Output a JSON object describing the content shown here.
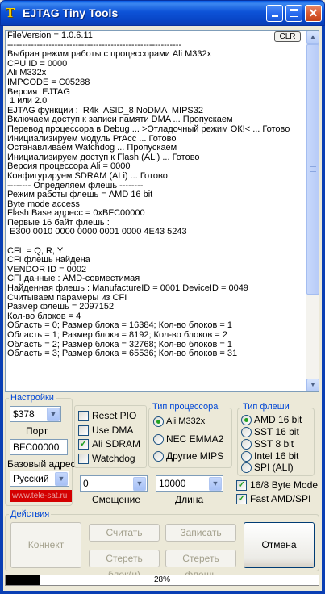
{
  "window": {
    "title": "EJTAG Tiny Tools",
    "icon_glyph": "T"
  },
  "log": {
    "clear_label": "CLR",
    "lines": [
      "FileVersion = 1.0.6.11",
      "-----------------------------------------------------------",
      "Выбран режим работы с процессорами Ali M332x",
      "CPU ID = 0000",
      "Ali M332x",
      "IMPCODE = C05288",
      "Версия  EJTAG",
      " 1 или 2.0",
      "EJTAG функции :  R4k  ASID_8 NoDMA  MIPS32",
      "Включаем доступ к записи памяти DMA ... Пропускаем",
      "Перевод процессора в Debug ... >Отладочный режим ОК!< ... Готово",
      "Инициализируем модуль PrAcc ... Готово",
      "Останавливаем Watchdog ... Пропускаем",
      "Инициализируем доступ к Flash (ALi) ... Готово",
      "Версия процессора Ali = 0000",
      "Конфигурируем SDRAM (ALi) ... Готово",
      "-------- Определяем флешь --------",
      "Режим работы флешь = AMD 16 bit",
      "Byte mode access",
      "Flash Base адресс = 0xBFC00000",
      "Первые 16 байт флешь :",
      " E300 0010 0000 0000 0001 0000 4E43 5243",
      "",
      "CFI  = Q, R, Y",
      "CFI флешь найдена",
      "VENDOR ID = 0002",
      "CFI данные : AMD-совместимая",
      "Найденная флешь : ManufactureID = 0001 DeviceID = 0049",
      "Считываем парамеры из CFI",
      "Размер флешь = 2097152",
      "Кол-во блоков = 4",
      "Область = 0; Размер блока = 16384; Кол-во блоков = 1",
      "Область = 1; Размер блока = 8192; Кол-во блоков = 2",
      "Область = 2; Размер блока = 32768; Кол-во блоков = 1",
      "Область = 3; Размер блока = 65536; Кол-во блоков = 31"
    ]
  },
  "settings": {
    "legend": "Настройки",
    "port_combo_value": "$378",
    "port_label": "Порт",
    "base_value": "BFC00000",
    "base_label": "Базовый адрес",
    "lang_value": "Русский",
    "site_text": "www.tele-sat.ru"
  },
  "options": {
    "reset_pio": "Reset PIO",
    "use_dma": "Use DMA",
    "ali_sdram": "Ali SDRAM",
    "watchdog": "Watchdog"
  },
  "cpu_type": {
    "legend": "Тип процессора",
    "opt1": "Ali M332x",
    "opt2": "NEC EMMA2",
    "opt3": "Другие MIPS"
  },
  "flash_type": {
    "legend": "Тип флеши",
    "opt1": "AMD  16 bit",
    "opt2": "SST   16 bit",
    "opt3": "SST     8 bit",
    "opt4": "Intel  16 bit",
    "opt5": "SPI  (ALI)",
    "byte_mode": "16/8 Byte Mode",
    "fast": "Fast AMD/SPI"
  },
  "offset": {
    "value": "0",
    "label": "Смещение"
  },
  "length": {
    "value": "10000",
    "label": "Длина"
  },
  "actions": {
    "legend": "Действия",
    "connect": "Коннект",
    "read": "Считать",
    "write": "Записать",
    "erase_blocks": "Стереть блок(и)",
    "erase_flash": "Стереть флешь",
    "cancel": "Отмена"
  },
  "progress": {
    "value": 28,
    "text": "28%"
  },
  "colors": {
    "title_blue": "#0a53d8",
    "link_red": "#d40000",
    "accent_green": "#21a121"
  }
}
